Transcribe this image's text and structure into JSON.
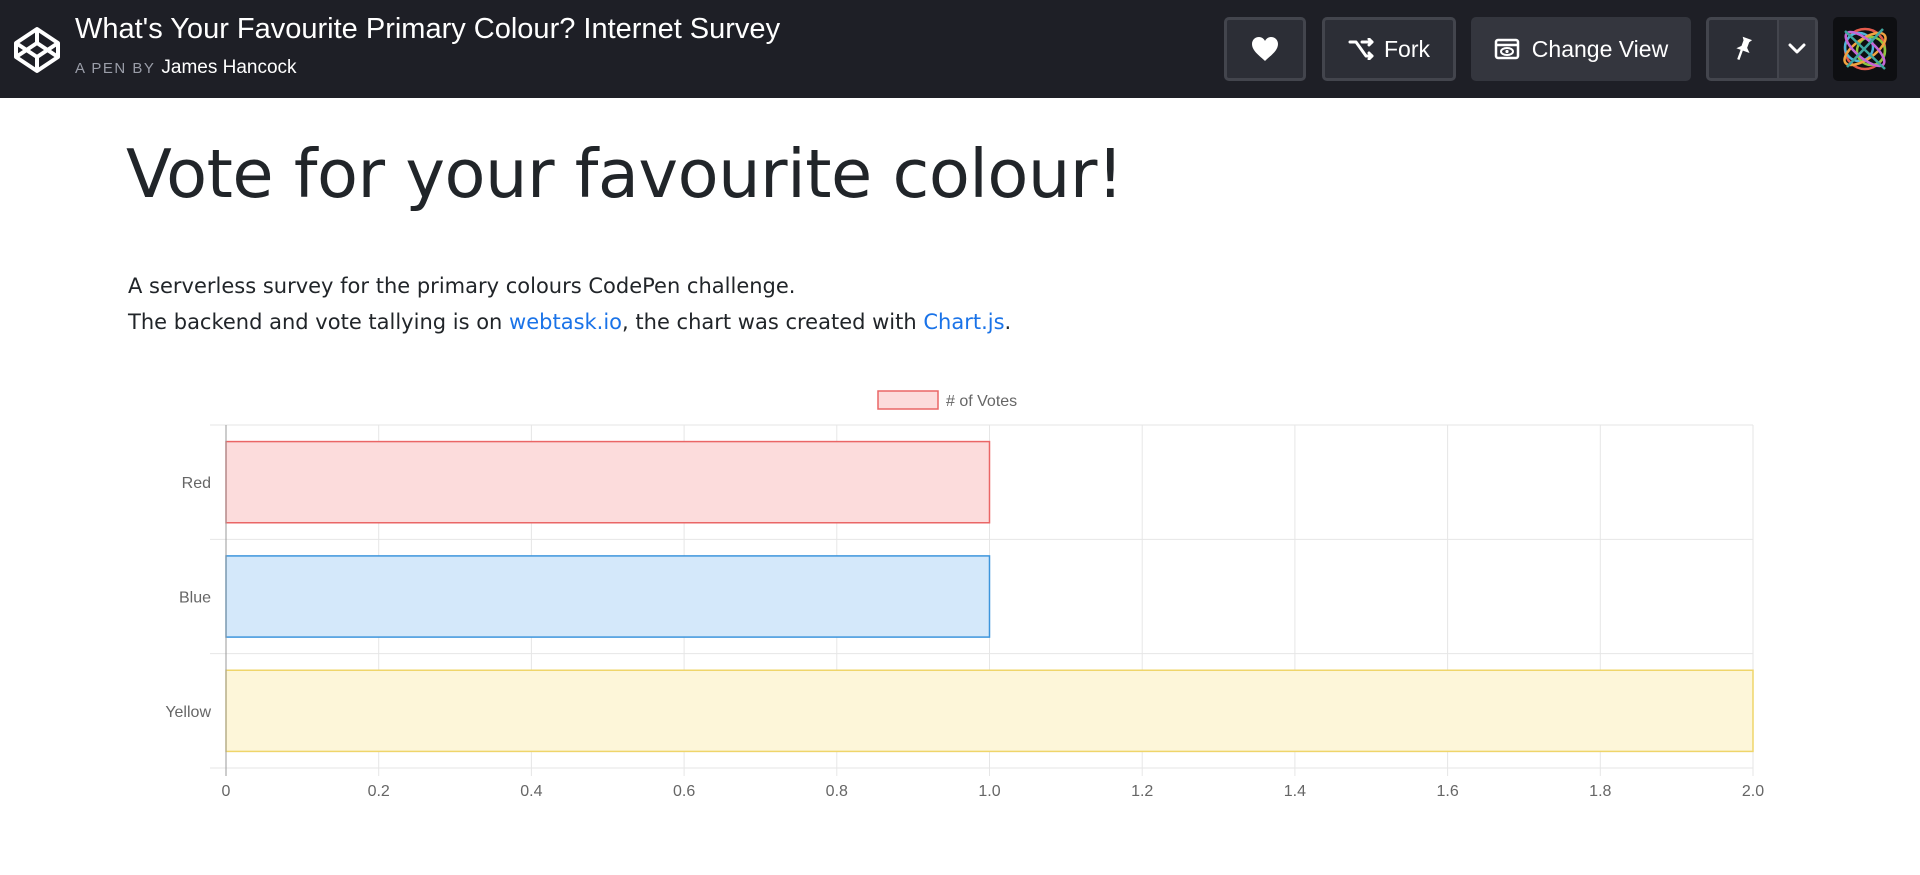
{
  "header": {
    "pen_title": "What's Your Favourite Primary Colour? Internet Survey",
    "by_label": "A PEN BY",
    "author": "James Hancock",
    "icons": {
      "logo": "codepen-logo-icon",
      "like": "heart-icon",
      "fork": "fork-icon",
      "view": "change-view-icon",
      "pin": "pin-icon",
      "more": "chevron-down-icon"
    },
    "fork_label": "Fork",
    "change_view_label": "Change View"
  },
  "page": {
    "heading": "Vote for your favourite colour!",
    "intro_line1": "A serverless survey for the primary colours CodePen challenge.",
    "intro_line2_before": "The backend and vote tallying is on ",
    "link1": "webtask.io",
    "intro_line2_middle": ", the chart was created with ",
    "link2": "Chart.js",
    "intro_line2_after": ".",
    "link_color": "#1a73e8"
  },
  "chart_data": {
    "type": "bar",
    "orientation": "horizontal",
    "categories": [
      "Red",
      "Blue",
      "Yellow"
    ],
    "series": [
      {
        "name": "# of Votes",
        "values": [
          1,
          1,
          2
        ],
        "fill_colors": [
          "#fcdcdc",
          "#d4e8fa",
          "#fdf6d9"
        ],
        "border_colors": [
          "#ea6666",
          "#3d95dc",
          "#efd56a"
        ]
      }
    ],
    "xlim": [
      0,
      2
    ],
    "x_ticks": [
      "0",
      "0.2",
      "0.4",
      "0.6",
      "0.8",
      "1.0",
      "1.2",
      "1.4",
      "1.6",
      "1.8",
      "2.0"
    ],
    "legend_position": "top",
    "grid": true,
    "title": "",
    "xlabel": "",
    "ylabel": ""
  }
}
